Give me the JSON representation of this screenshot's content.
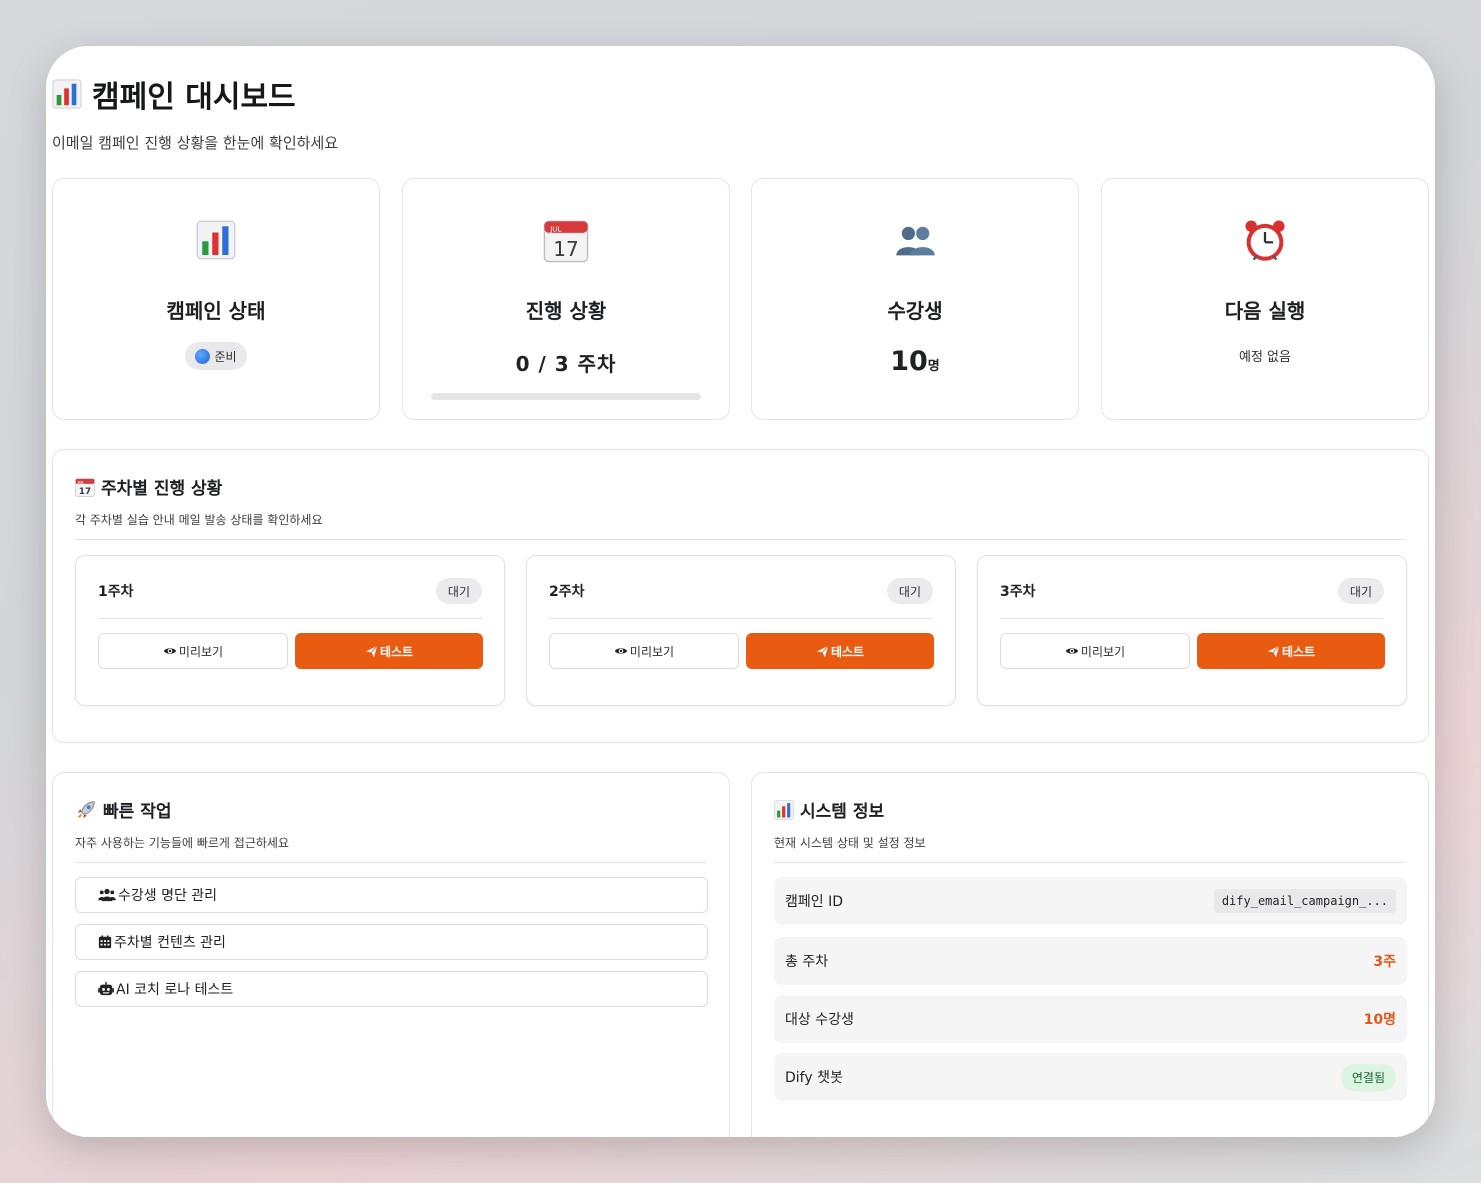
{
  "header": {
    "title": "캠페인 대시보드",
    "subtitle": "이메일 캠페인 진행 상황을 한눈에 확인하세요"
  },
  "stats": {
    "status": {
      "title": "캠페인 상태",
      "badge": "준비"
    },
    "progress": {
      "title": "진행 상황",
      "text": "0 / 3 주차",
      "fraction": 0
    },
    "students": {
      "title": "수강생",
      "count": "10",
      "unit": "명"
    },
    "next_run": {
      "title": "다음 실행",
      "text": "예정 없음"
    }
  },
  "weekly": {
    "title": "주차별 진행 상황",
    "subtitle": "각 주차별 실습 안내 메일 발송 상태를 확인하세요",
    "weeks": [
      {
        "label": "1주차",
        "status": "대기",
        "preview": "미리보기",
        "test": "테스트"
      },
      {
        "label": "2주차",
        "status": "대기",
        "preview": "미리보기",
        "test": "테스트"
      },
      {
        "label": "3주차",
        "status": "대기",
        "preview": "미리보기",
        "test": "테스트"
      }
    ]
  },
  "quick": {
    "title": "빠른 작업",
    "subtitle": "자주 사용하는 기능들에 빠르게 접근하세요",
    "actions": [
      {
        "label": "수강생 명단 관리",
        "icon": "users-icon"
      },
      {
        "label": "주차별 컨텐츠 관리",
        "icon": "calendar-icon"
      },
      {
        "label": "AI 코치 로나 테스트",
        "icon": "robot-icon"
      }
    ]
  },
  "system": {
    "title": "시스템 정보",
    "subtitle": "현재 시스템 상태 및 설정 정보",
    "rows": [
      {
        "label": "캠페인 ID",
        "value": "dify_email_campaign_..."
      },
      {
        "label": "총 주차",
        "value": "3주"
      },
      {
        "label": "대상 수강생",
        "value": "10명"
      },
      {
        "label": "Dify 챗봇",
        "value": "연결됨"
      }
    ]
  },
  "colors": {
    "accent": "#ea5b12",
    "success_bg": "#dcf5e3",
    "status_dot": "#1b63d6"
  }
}
